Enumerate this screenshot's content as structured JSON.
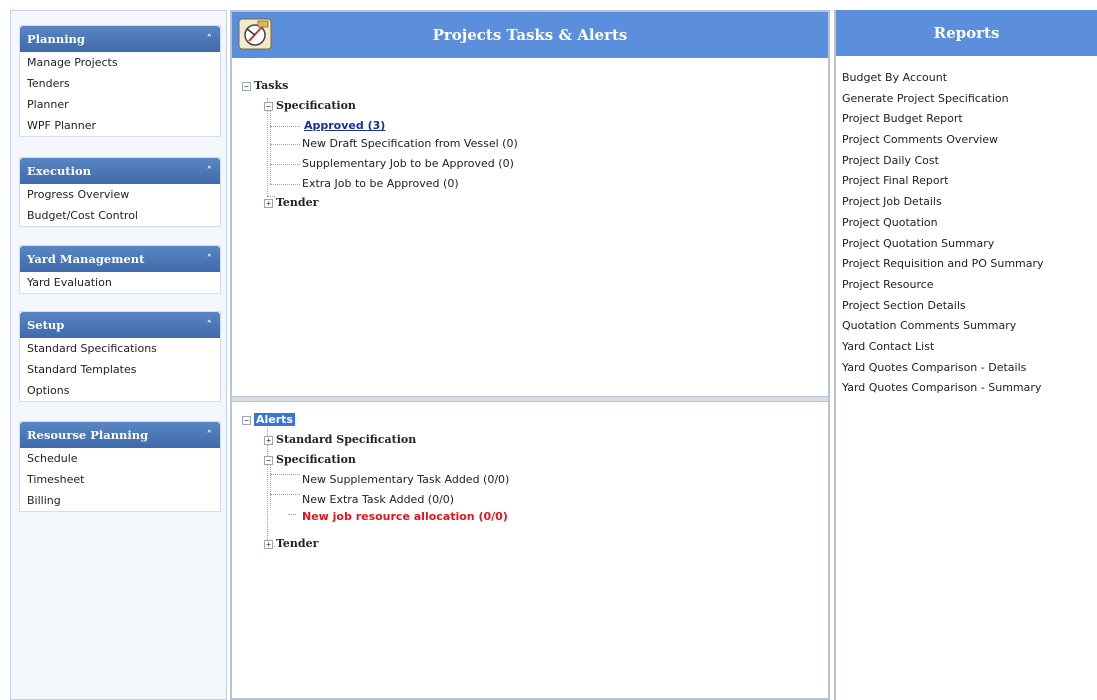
{
  "sidebar": {
    "groups": [
      {
        "title": "Planning",
        "collapse_icon": "chevron-up-icon",
        "items": [
          "Manage Projects",
          "Tenders",
          "Planner",
          "WPF Planner"
        ]
      },
      {
        "title": "Execution",
        "collapse_icon": "chevron-up-icon",
        "items": [
          "Progress Overview",
          "Budget/Cost Control"
        ]
      },
      {
        "title": "Yard Management",
        "collapse_icon": "chevron-up-icon",
        "items": [
          "Yard Evaluation"
        ]
      },
      {
        "title": "Setup",
        "collapse_icon": "chevron-up-icon",
        "items": [
          "Standard Specifications",
          "Standard Templates",
          "Options"
        ]
      },
      {
        "title": "Resourse Planning",
        "collapse_icon": "chevron-up-icon",
        "items": [
          "Schedule",
          "Timesheet",
          "Billing"
        ]
      }
    ]
  },
  "center": {
    "title": "Projects Tasks & Alerts",
    "tasks": {
      "root": "Tasks",
      "specification": "Specification",
      "items": [
        "Approved (3)",
        "New Draft Specification from Vessel (0)",
        "Supplementary Job to be Approved (0)",
        "Extra Job to be Approved (0)"
      ],
      "tender": "Tender"
    },
    "alerts": {
      "root": "Alerts",
      "standard_specification": "Standard Specification",
      "specification": "Specification",
      "items": [
        "New Supplementary Task Added (0/0)",
        "New Extra Task Added (0/0)"
      ],
      "resource_alert": "New job resource allocation (0/0)",
      "tender": "Tender"
    }
  },
  "reports": {
    "title": "Reports",
    "items": [
      "Budget By Account",
      "Generate Project Specification",
      "Project Budget Report",
      "Project Comments Overview",
      "Project Daily Cost",
      "Project Final Report",
      "Project Job Details",
      "Project Quotation",
      "Project Quotation Summary",
      "Project Requisition and PO Summary",
      "Project Resource",
      "Project Section Details",
      "Quotation Comments Summary",
      "Yard Contact List",
      "Yard Quotes Comparison - Details",
      "Yard Quotes Comparison - Summary"
    ]
  },
  "colors": {
    "header_blue": "#5b8fdc",
    "group_header_blue": "#3f6aab",
    "link_blue": "#1a2f9c",
    "alert_red": "#e0161d",
    "selection_blue": "#3b74d8"
  }
}
